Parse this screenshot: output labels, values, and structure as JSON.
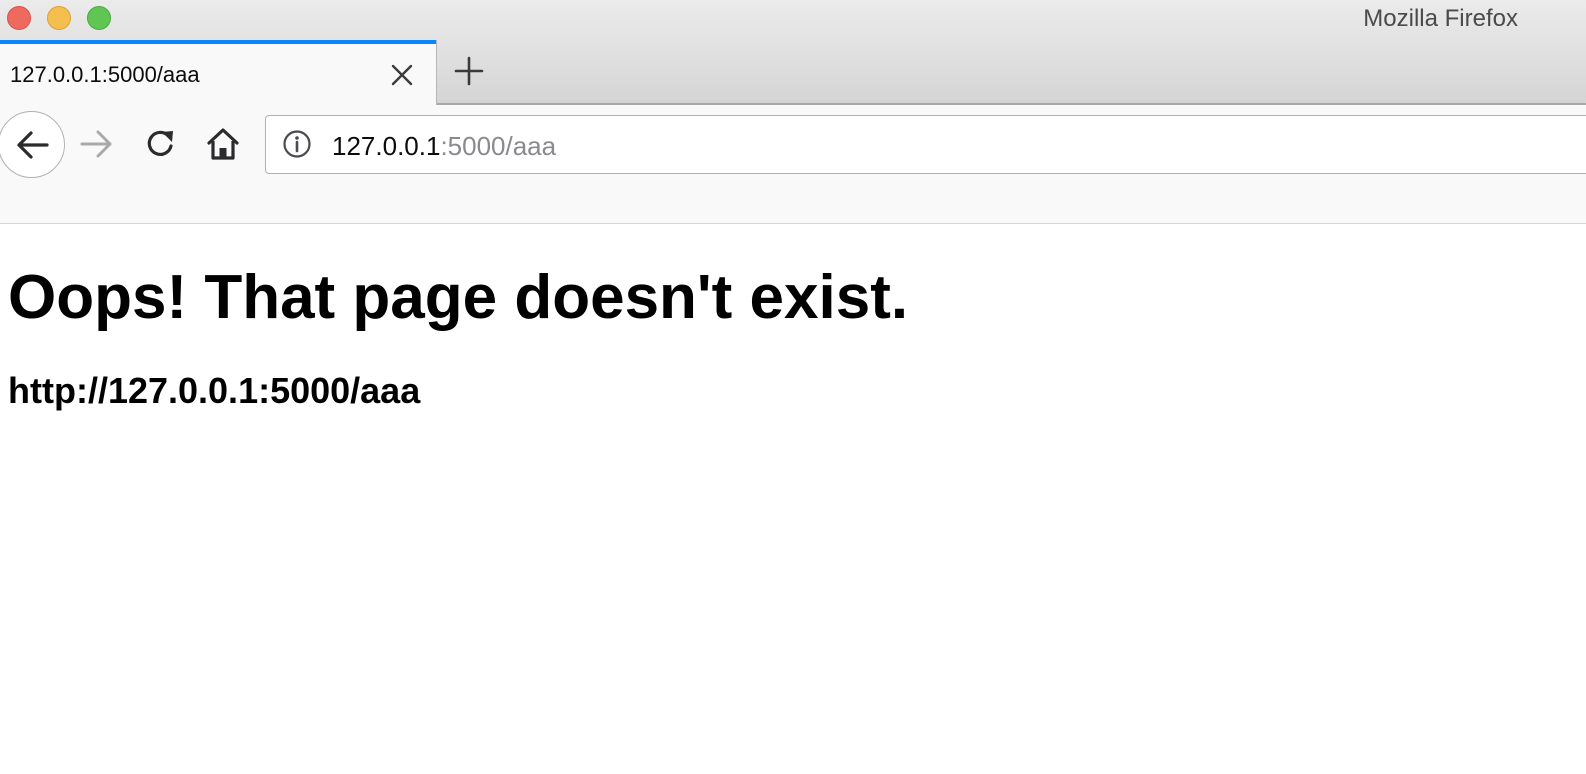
{
  "window": {
    "title": "Mozilla Firefox"
  },
  "tabs": [
    {
      "title": "127.0.0.1:5000/aaa",
      "active": true
    }
  ],
  "toolbar": {
    "icons": {
      "back": "back-arrow-icon",
      "forward": "forward-arrow-icon",
      "reload": "reload-icon",
      "home": "home-icon",
      "info": "info-icon",
      "close_tab": "close-icon",
      "new_tab": "plus-icon"
    },
    "forward_enabled": false
  },
  "urlbar": {
    "host": "127.0.0.1",
    "rest": ":5000/aaa"
  },
  "page": {
    "heading": "Oops! That page doesn't exist.",
    "url": "http://127.0.0.1:5000/aaa"
  },
  "colors": {
    "tab_accent": "#0a84ff",
    "close_button": "#ee6a5e",
    "minimize_button": "#f5bf4f",
    "maximize_button": "#61c554"
  }
}
